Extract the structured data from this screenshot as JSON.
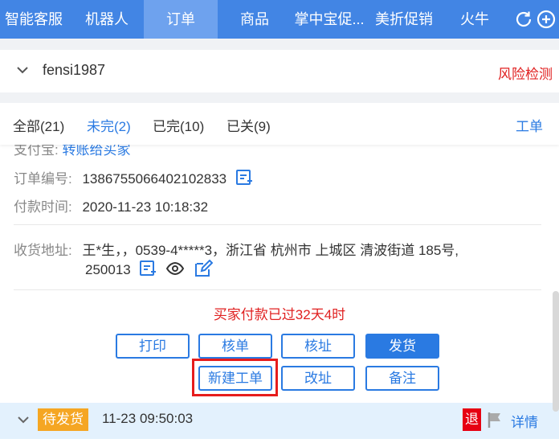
{
  "nav": {
    "tabs": [
      {
        "label": "智能客服"
      },
      {
        "label": "机器人"
      },
      {
        "label": "订单"
      },
      {
        "label": "商品"
      },
      {
        "label": "掌中宝促..."
      },
      {
        "label": "美折促销"
      },
      {
        "label": "火牛"
      }
    ],
    "active_tab": "订单",
    "icons": [
      "refresh-icon",
      "add-circle-icon"
    ]
  },
  "account": {
    "name": "fensi1987",
    "risk_label": "风险检测"
  },
  "filters": {
    "items": [
      {
        "label": "全部(21)"
      },
      {
        "label": "未完(2)"
      },
      {
        "label": "已完(10)"
      },
      {
        "label": "已关(9)"
      }
    ],
    "active": "未完(2)",
    "ticket_label": "工单"
  },
  "order": {
    "alipay_label": "支付宝:",
    "alipay_link": "转账给买家",
    "order_no_label": "订单编号:",
    "order_no": "1386755066402102833",
    "paid_time_label": "付款时间:",
    "paid_time": "2020-11-23 10:18:32",
    "address_label": "收货地址:",
    "address_line1": "王*生，，0539-4*****3，浙江省 杭州市 上城区 清波街道 185号,",
    "address_line2": "250013",
    "payment_warning": "买家付款已过32天4时",
    "buttons": {
      "print": "打印",
      "verify_order": "核单",
      "verify_address": "核址",
      "ship": "发货",
      "new_ticket": "新建工单",
      "change_address": "改址",
      "note": "备注"
    }
  },
  "pending": {
    "status": "待发货",
    "time": "11-23 09:50:03",
    "refund_badge": "退",
    "detail_link": "详情"
  },
  "colors": {
    "nav_bg": "#4285e4",
    "accent": "#2a7ae2",
    "danger": "#e02020",
    "badge_orange": "#f5a623",
    "highlight_red": "#e61c1c"
  }
}
